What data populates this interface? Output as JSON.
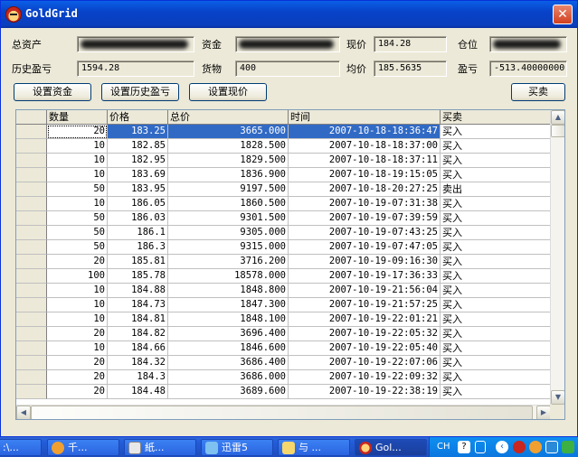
{
  "window": {
    "title": "GoldGrid",
    "close_label": "✕"
  },
  "summary": {
    "total_assets_label": "总资产",
    "funds_label": "资金",
    "current_price_label": "现价",
    "current_price_value": "184.28",
    "position_label": "仓位",
    "history_pl_label": "历史盈亏",
    "history_pl_value": "1594.28",
    "goods_label": "货物",
    "goods_value": "400",
    "avg_price_label": "均价",
    "avg_price_value": "185.5635",
    "pl_label": "盈亏",
    "pl_value": "-513.40000000"
  },
  "buttons": {
    "set_funds": "设置资金",
    "set_history_pl": "设置历史盈亏",
    "set_current_price": "设置现价",
    "trade": "买卖"
  },
  "grid": {
    "columns": [
      "数量",
      "价格",
      "总价",
      "时间",
      "买卖"
    ],
    "rows": [
      {
        "qty": "20",
        "price": "183.25",
        "total": "3665.000",
        "time": "2007-10-18-18:36:47",
        "type": "买入"
      },
      {
        "qty": "10",
        "price": "182.85",
        "total": "1828.500",
        "time": "2007-10-18-18:37:00",
        "type": "买入"
      },
      {
        "qty": "10",
        "price": "182.95",
        "total": "1829.500",
        "time": "2007-10-18-18:37:11",
        "type": "买入"
      },
      {
        "qty": "10",
        "price": "183.69",
        "total": "1836.900",
        "time": "2007-10-18-19:15:05",
        "type": "买入"
      },
      {
        "qty": "50",
        "price": "183.95",
        "total": "9197.500",
        "time": "2007-10-18-20:27:25",
        "type": "卖出"
      },
      {
        "qty": "10",
        "price": "186.05",
        "total": "1860.500",
        "time": "2007-10-19-07:31:38",
        "type": "买入"
      },
      {
        "qty": "50",
        "price": "186.03",
        "total": "9301.500",
        "time": "2007-10-19-07:39:59",
        "type": "买入"
      },
      {
        "qty": "50",
        "price": "186.1",
        "total": "9305.000",
        "time": "2007-10-19-07:43:25",
        "type": "买入"
      },
      {
        "qty": "50",
        "price": "186.3",
        "total": "9315.000",
        "time": "2007-10-19-07:47:05",
        "type": "买入"
      },
      {
        "qty": "20",
        "price": "185.81",
        "total": "3716.200",
        "time": "2007-10-19-09:16:30",
        "type": "买入"
      },
      {
        "qty": "100",
        "price": "185.78",
        "total": "18578.000",
        "time": "2007-10-19-17:36:33",
        "type": "买入"
      },
      {
        "qty": "10",
        "price": "184.88",
        "total": "1848.800",
        "time": "2007-10-19-21:56:04",
        "type": "买入"
      },
      {
        "qty": "10",
        "price": "184.73",
        "total": "1847.300",
        "time": "2007-10-19-21:57:25",
        "type": "买入"
      },
      {
        "qty": "10",
        "price": "184.81",
        "total": "1848.100",
        "time": "2007-10-19-22:01:21",
        "type": "买入"
      },
      {
        "qty": "20",
        "price": "184.82",
        "total": "3696.400",
        "time": "2007-10-19-22:05:32",
        "type": "买入"
      },
      {
        "qty": "10",
        "price": "184.66",
        "total": "1846.600",
        "time": "2007-10-19-22:05:40",
        "type": "买入"
      },
      {
        "qty": "20",
        "price": "184.32",
        "total": "3686.400",
        "time": "2007-10-19-22:07:06",
        "type": "买入"
      },
      {
        "qty": "20",
        "price": "184.3",
        "total": "3686.000",
        "time": "2007-10-19-22:09:32",
        "type": "买入"
      },
      {
        "qty": "20",
        "price": "184.48",
        "total": "3689.600",
        "time": "2007-10-19-22:38:19",
        "type": "买入"
      }
    ]
  },
  "taskbar": {
    "items": [
      ":\\...",
      "千...",
      "紙...",
      "迅雷5",
      "与 ...",
      "Gol..."
    ],
    "lang": "CH"
  },
  "colors": {
    "title_bar": "#0a3fbd",
    "selection": "#316ac5",
    "window_bg": "#ece9d8"
  }
}
